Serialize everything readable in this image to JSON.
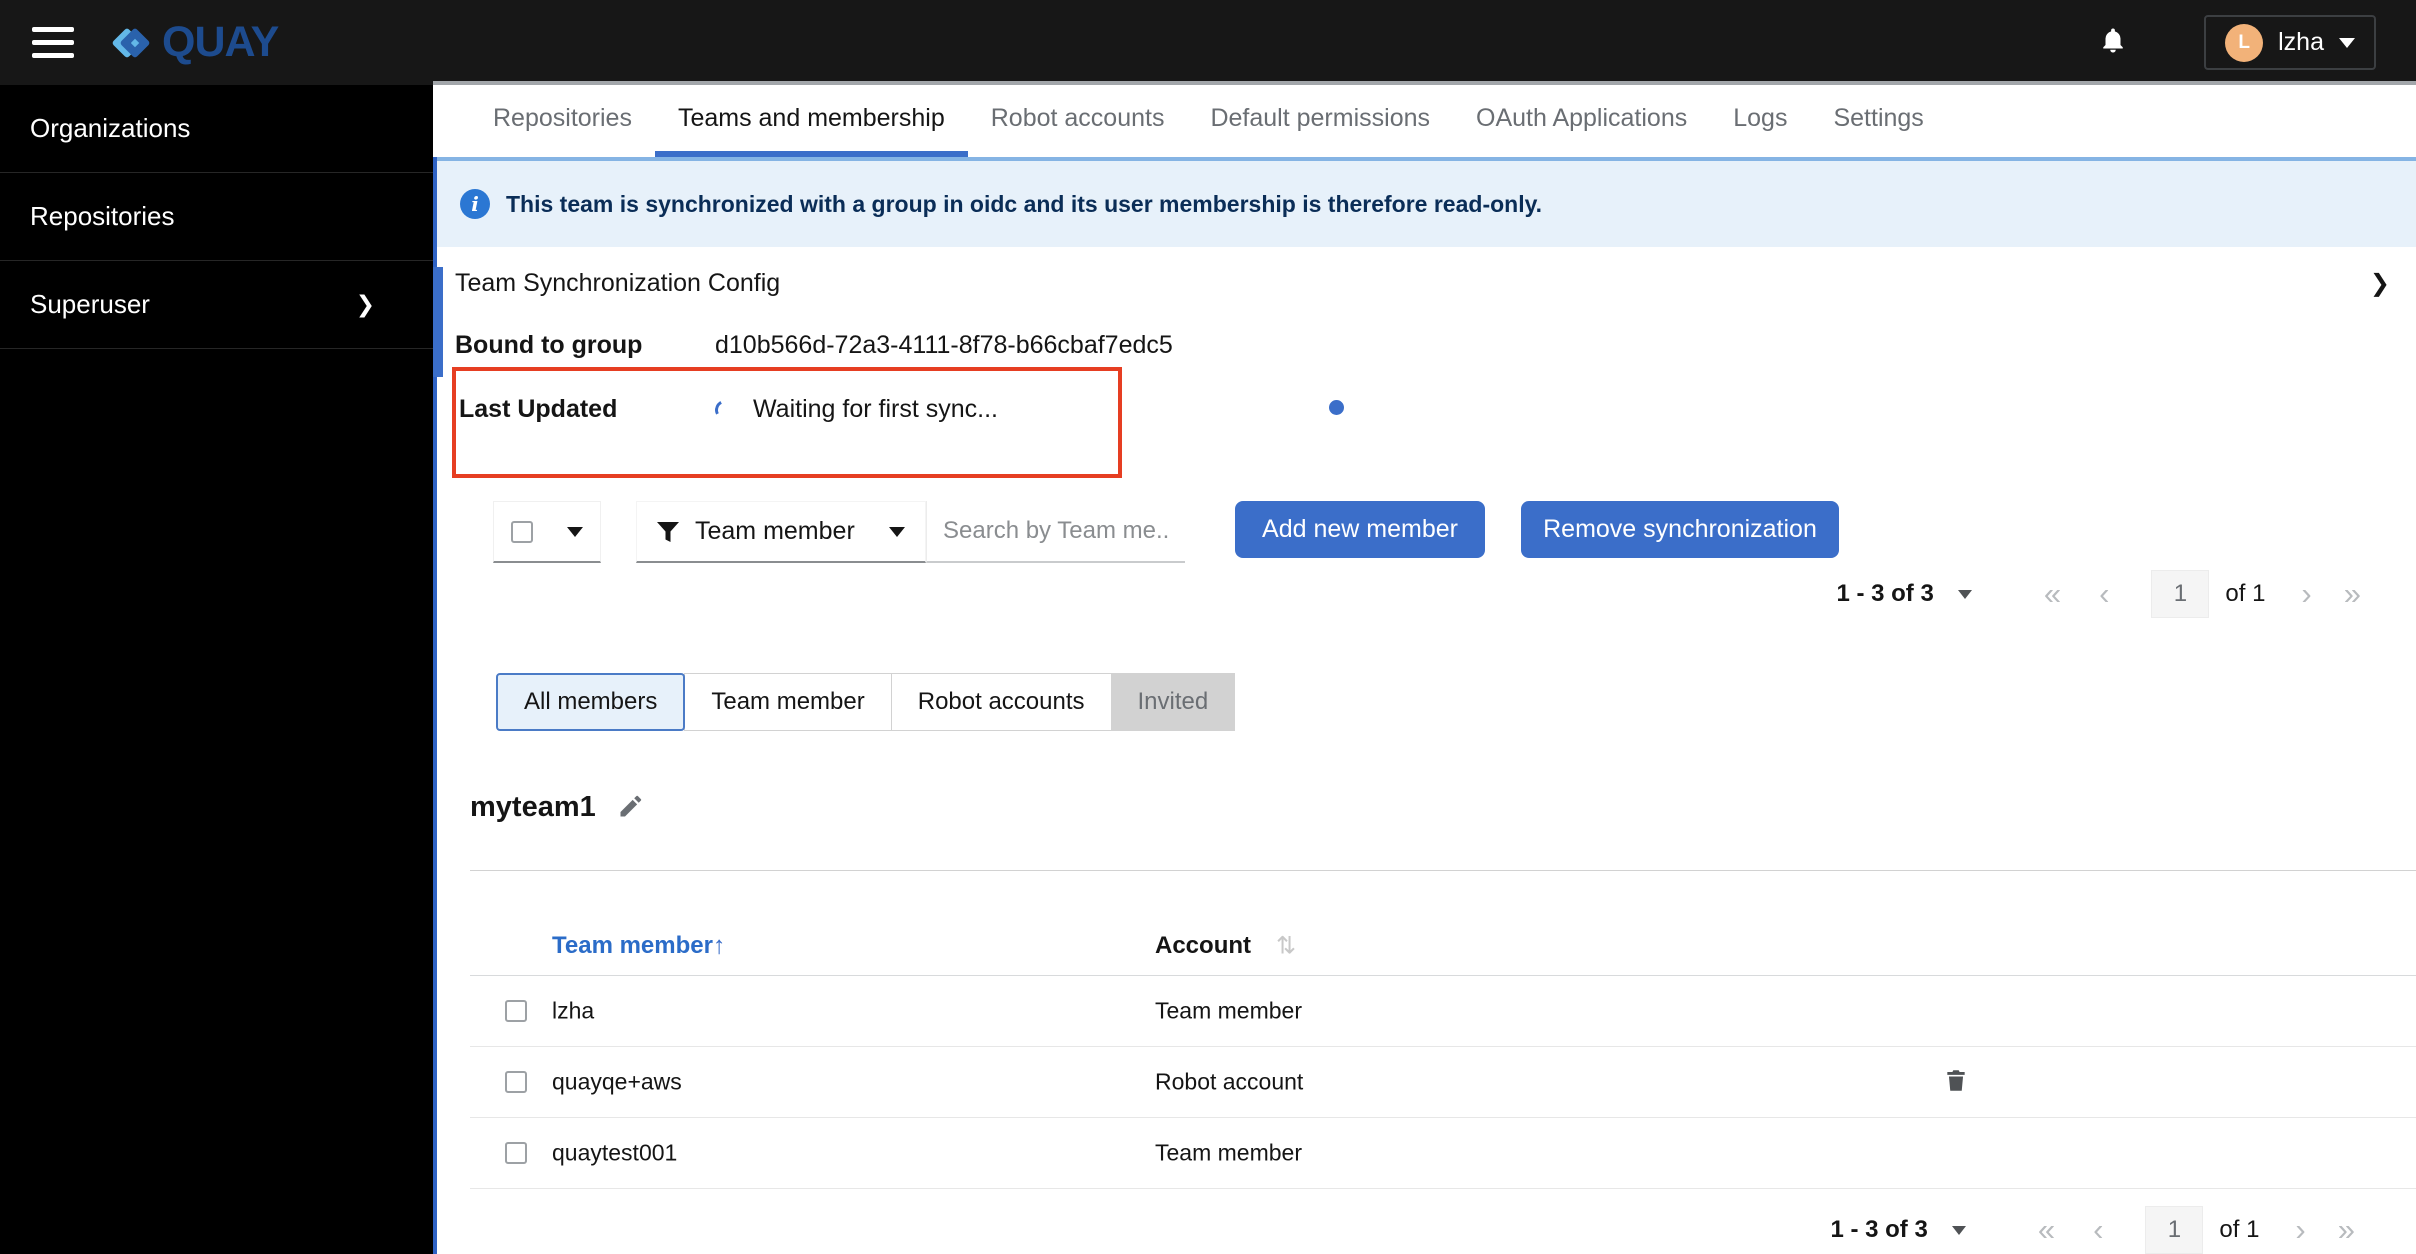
{
  "header": {
    "brand": "QUAY",
    "user": {
      "name": "lzha",
      "avatar_initial": "L"
    }
  },
  "sidebar": {
    "items": [
      {
        "label": "Organizations"
      },
      {
        "label": "Repositories"
      },
      {
        "label": "Superuser",
        "has_submenu": true
      }
    ]
  },
  "tabs": [
    {
      "label": "Repositories"
    },
    {
      "label": "Teams and membership",
      "active": true
    },
    {
      "label": "Robot accounts"
    },
    {
      "label": "Default permissions"
    },
    {
      "label": "OAuth Applications"
    },
    {
      "label": "Logs"
    },
    {
      "label": "Settings"
    }
  ],
  "banner": {
    "text": "This team is synchronized with a group in oidc and its user membership is therefore read-only."
  },
  "sync_config": {
    "title": "Team Synchronization Config",
    "bound_label": "Bound to group",
    "bound_value": "d10b566d-72a3-4111-8f78-b66cbaf7edc5",
    "last_updated_label": "Last Updated",
    "last_updated_value": "Waiting for first sync..."
  },
  "toolbar": {
    "filter_label": "Team member",
    "search_placeholder": "Search by Team me...",
    "add_button": "Add new member",
    "remove_button": "Remove synchronization"
  },
  "pagination": {
    "range": "1 - 3 of 3",
    "page": "1",
    "of_label": "of 1"
  },
  "member_filters": [
    {
      "label": "All members",
      "state": "selected"
    },
    {
      "label": "Team member",
      "state": "default"
    },
    {
      "label": "Robot accounts",
      "state": "default"
    },
    {
      "label": "Invited",
      "state": "disabled"
    }
  ],
  "team": {
    "name": "myteam1"
  },
  "table": {
    "columns": [
      {
        "label": "Team member",
        "sorted": "asc"
      },
      {
        "label": "Account",
        "sorted": "none"
      }
    ],
    "rows": [
      {
        "name": "lzha",
        "account": "Team member",
        "deletable": false
      },
      {
        "name": "quayqe+aws",
        "account": "Robot account",
        "deletable": true
      },
      {
        "name": "quaytest001",
        "account": "Team member",
        "deletable": false
      }
    ]
  },
  "glyphs": {
    "chevron_right": "❯",
    "first": "«",
    "prev": "‹",
    "next": "›",
    "last": "»",
    "sort_asc": "↑",
    "sort_both": "⇅"
  },
  "colors": {
    "accent_blue": "#3b6ec9",
    "sorted_header_blue": "#2b6cc8",
    "banner_bg": "#e7f1fa",
    "banner_text": "#0a2d57",
    "highlight_red": "#e63e22",
    "avatar_orange": "#f2b279",
    "header_bg": "#171717",
    "sidebar_bg": "#000000",
    "muted_text": "#6a6e73"
  }
}
